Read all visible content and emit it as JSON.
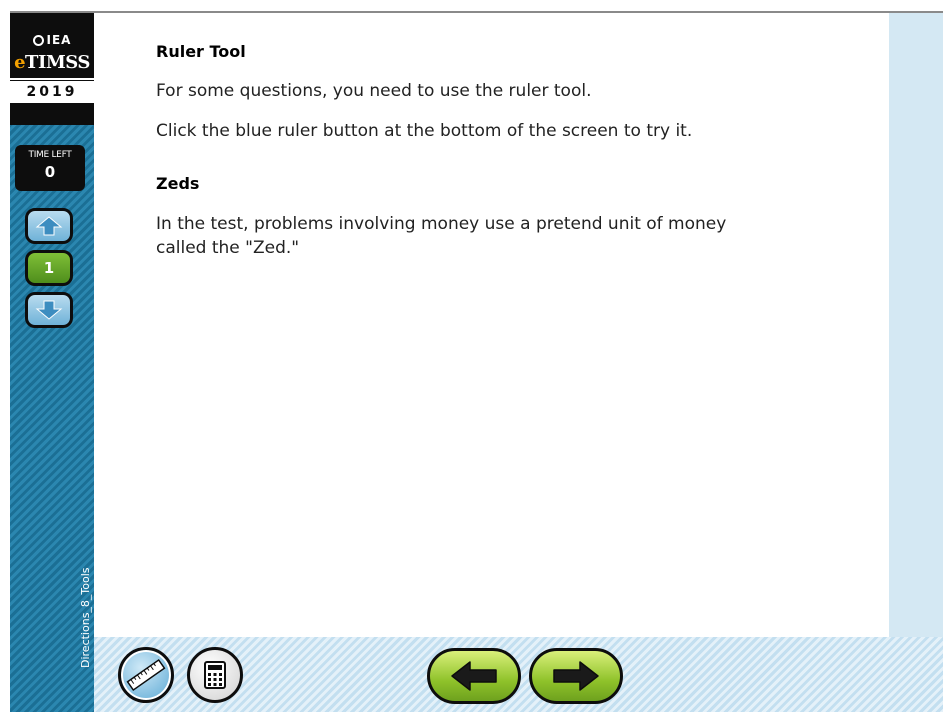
{
  "logo": {
    "org": "IEA",
    "brand_prefix": "e",
    "brand": "TIMSS",
    "year": "2019"
  },
  "timer": {
    "label": "TIME LEFT",
    "value": "0"
  },
  "nav": {
    "current_item": "1"
  },
  "screen_id": "Directions_8_Tools",
  "sections": [
    {
      "heading": "Ruler Tool",
      "paragraphs": [
        "For some questions, you need to use the ruler tool.",
        "Click the blue ruler button at the bottom of the screen to try it."
      ]
    },
    {
      "heading": "Zeds",
      "paragraphs": [
        "In the test, problems involving money use a pretend unit of money called the \"Zed.\""
      ]
    }
  ],
  "toolbar": {
    "ruler_icon": "ruler-icon",
    "calculator_icon": "calculator-icon",
    "back_icon": "arrow-left-icon",
    "next_icon": "arrow-right-icon"
  },
  "colors": {
    "sidebar": "#1b6f95",
    "logo_bg": "#0d0d0d",
    "accent_orange": "#f2a000",
    "nav_green": "#5d9b22",
    "pill_green": "#8fc22a",
    "light_blue": "#d4e8f3"
  }
}
